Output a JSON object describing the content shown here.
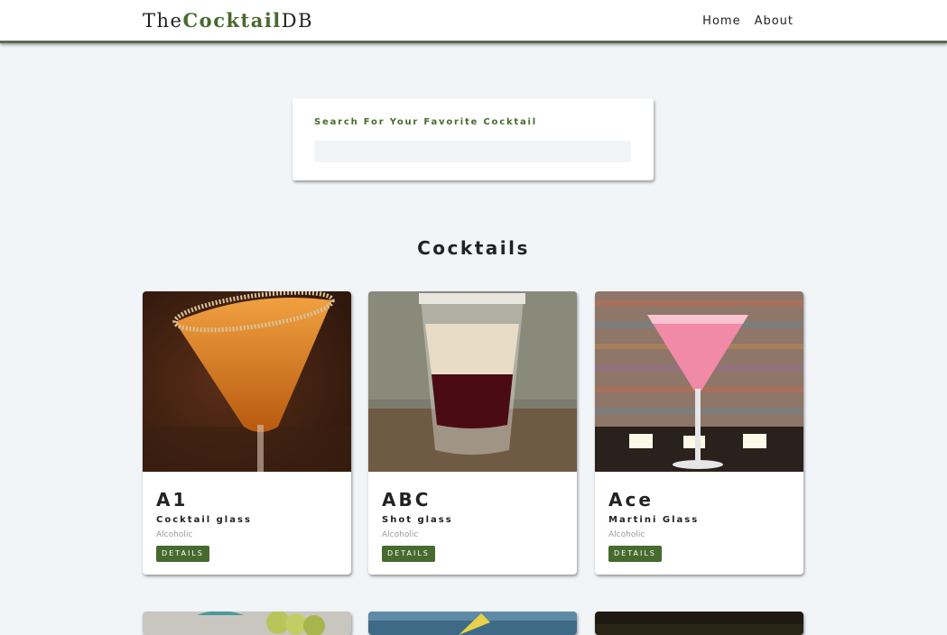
{
  "navbar": {
    "logo_prefix": "The",
    "logo_accent": "Cocktail",
    "logo_suffix": "DB",
    "links": [
      "Home",
      "About"
    ]
  },
  "search": {
    "label": "Search For Your Favorite Cocktail",
    "value": "",
    "placeholder": ""
  },
  "section": {
    "title": "Cocktails"
  },
  "cards": [
    {
      "name": "A1",
      "glass": "Cocktail glass",
      "info": "Alcoholic",
      "button": "DETAILS",
      "image": "orange-cocktail-photo"
    },
    {
      "name": "ABC",
      "glass": "Shot glass",
      "info": "Alcoholic",
      "button": "DETAILS",
      "image": "layered-shot-photo"
    },
    {
      "name": "Ace",
      "glass": "Martini Glass",
      "info": "Alcoholic",
      "button": "DETAILS",
      "image": "pink-martini-photo"
    }
  ],
  "colors": {
    "accent": "#476a2e",
    "background": "#f1f5f8",
    "navbar_border": "#5c6b55"
  }
}
